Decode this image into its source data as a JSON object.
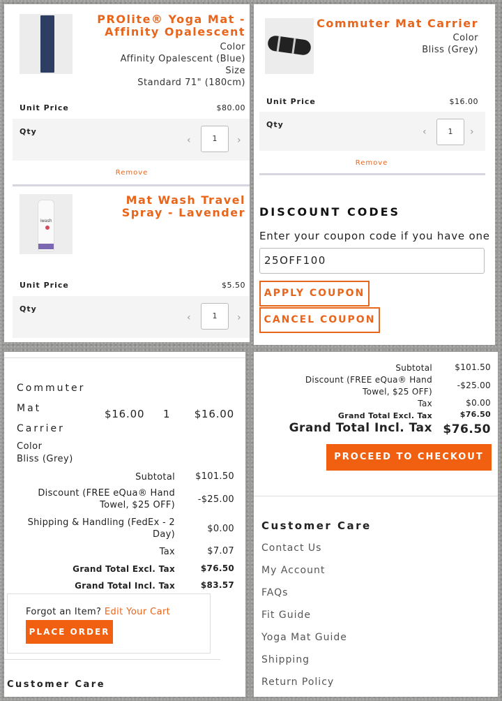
{
  "panel1": {
    "item1": {
      "title_line1": "PROlite® Yoga Mat -",
      "title_line2": "Affinity Opalescent",
      "color_label": "Color",
      "color_value": "Affinity Opalescent (Blue)",
      "size_label": "Size",
      "size_value": "Standard 71\" (180cm)",
      "unit_price_label": "Unit Price",
      "unit_price": "$80.00",
      "qty_label": "Qty",
      "qty": "1",
      "remove_label": "Remove"
    },
    "item2": {
      "title_line1": "Mat Wash Travel",
      "title_line2": "Spray - Lavender",
      "thumb_label": "iwash",
      "unit_price_label": "Unit Price",
      "unit_price": "$5.50",
      "qty_label": "Qty",
      "qty": "1"
    }
  },
  "panel2": {
    "item": {
      "title": "Commuter Mat Carrier",
      "color_label": "Color",
      "color_value": "Bliss (Grey)",
      "unit_price_label": "Unit Price",
      "unit_price": "$16.00",
      "qty_label": "Qty",
      "qty": "1",
      "remove_label": "Remove"
    },
    "discount": {
      "heading": "DISCOUNT CODES",
      "prompt": "Enter your coupon code if you have one",
      "code_value": "25OFF100",
      "apply_label": "APPLY COUPON",
      "cancel_label": "CANCEL COUPON"
    }
  },
  "panel3": {
    "item": {
      "name_line1": "Commuter",
      "name_line2": "Mat",
      "name_line3": "Carrier",
      "price": "$16.00",
      "qty": "1",
      "total": "$16.00",
      "color_label": "Color",
      "color_value": "Bliss (Grey)"
    },
    "totals": {
      "subtotal_label": "Subtotal",
      "subtotal": "$101.50",
      "discount_label_line1": "Discount (FREE eQua® Hand",
      "discount_label_line2": "Towel, $25 OFF)",
      "discount": "-$25.00",
      "shipping_label_line1": "Shipping & Handling (FedEx - 2",
      "shipping_label_line2": "Day)",
      "shipping": "$0.00",
      "tax_label": "Tax",
      "tax": "$7.07",
      "gt_excl_label": "Grand Total Excl. Tax",
      "gt_excl": "$76.50",
      "gt_incl_label": "Grand Total Incl. Tax",
      "gt_incl": "$83.57"
    },
    "forgot_text": "Forgot an Item?",
    "edit_cart_label": "Edit Your Cart",
    "place_order_label": "PLACE ORDER",
    "customer_care": "Customer Care"
  },
  "panel4": {
    "totals": {
      "subtotal_label": "Subtotal",
      "subtotal": "$101.50",
      "discount_label_line1": "Discount (FREE eQua® Hand",
      "discount_label_line2": "Towel, $25 OFF)",
      "discount": "-$25.00",
      "tax_label": "Tax",
      "tax": "$0.00",
      "gt_excl_label": "Grand Total Excl. Tax",
      "gt_excl": "$76.50",
      "gt_incl_label": "Grand Total Incl. Tax",
      "gt_incl": "$76.50"
    },
    "checkout_label": "PROCEED TO CHECKOUT",
    "customer_care": {
      "heading": "Customer Care",
      "links": [
        "Contact Us",
        "My Account",
        "FAQs",
        "Fit Guide",
        "Yoga Mat Guide",
        "Shipping",
        "Return Policy"
      ]
    }
  },
  "colors": {
    "accent": "#e8651c",
    "button": "#f15f10"
  }
}
